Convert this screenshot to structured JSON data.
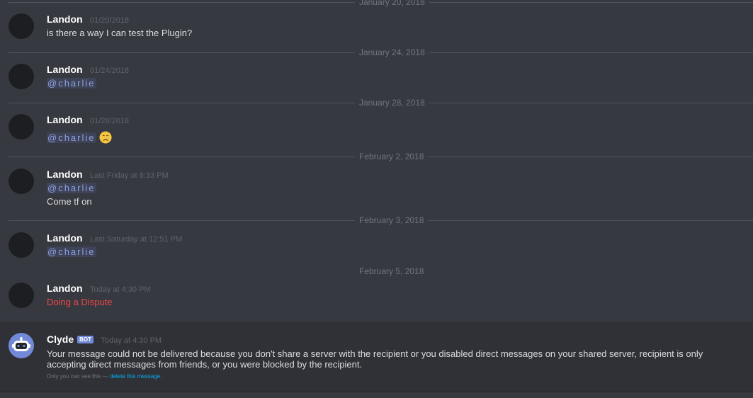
{
  "dividers": [
    "January 20, 2018",
    "January 24, 2018",
    "January 28, 2018",
    "February 2, 2018",
    "February 3, 2018",
    "February 5, 2018"
  ],
  "messages": [
    {
      "author": "Landon",
      "timestamp": "01/20/2018",
      "text": "is there a way I can test the Plugin?"
    },
    {
      "author": "Landon",
      "timestamp": "01/24/2018",
      "mention": "@charlie"
    },
    {
      "author": "Landon",
      "timestamp": "01/28/2018",
      "mention": "@charlie",
      "emoji": "crying-face"
    },
    {
      "author": "Landon",
      "timestamp": "Last Friday at 8:33 PM",
      "mention": "@charlie",
      "text": "Come tf on"
    },
    {
      "author": "Landon",
      "timestamp": "Last Saturday at 12:51 PM",
      "mention": "@charlie"
    },
    {
      "author": "Landon",
      "timestamp": "Today at 4:30 PM",
      "text": "Doing a Dispute",
      "text_color": "#f04747"
    }
  ],
  "clyde": {
    "author": "Clyde",
    "badge": "BOT",
    "timestamp": "Today at 4:30 PM",
    "text": "Your message could not be delivered because you don't share a server with the recipient or you disabled direct messages on your shared server, recipient is only accepting direct messages from friends, or you were blocked by the recipient.",
    "note": "Only you can see this —",
    "note_link": "delete this message."
  },
  "colors": {
    "background": "#36393f",
    "mention_bg": "#3e4358",
    "mention_text": "#8ea1e1",
    "bot_badge": "#7289da",
    "link": "#00b0f4"
  }
}
